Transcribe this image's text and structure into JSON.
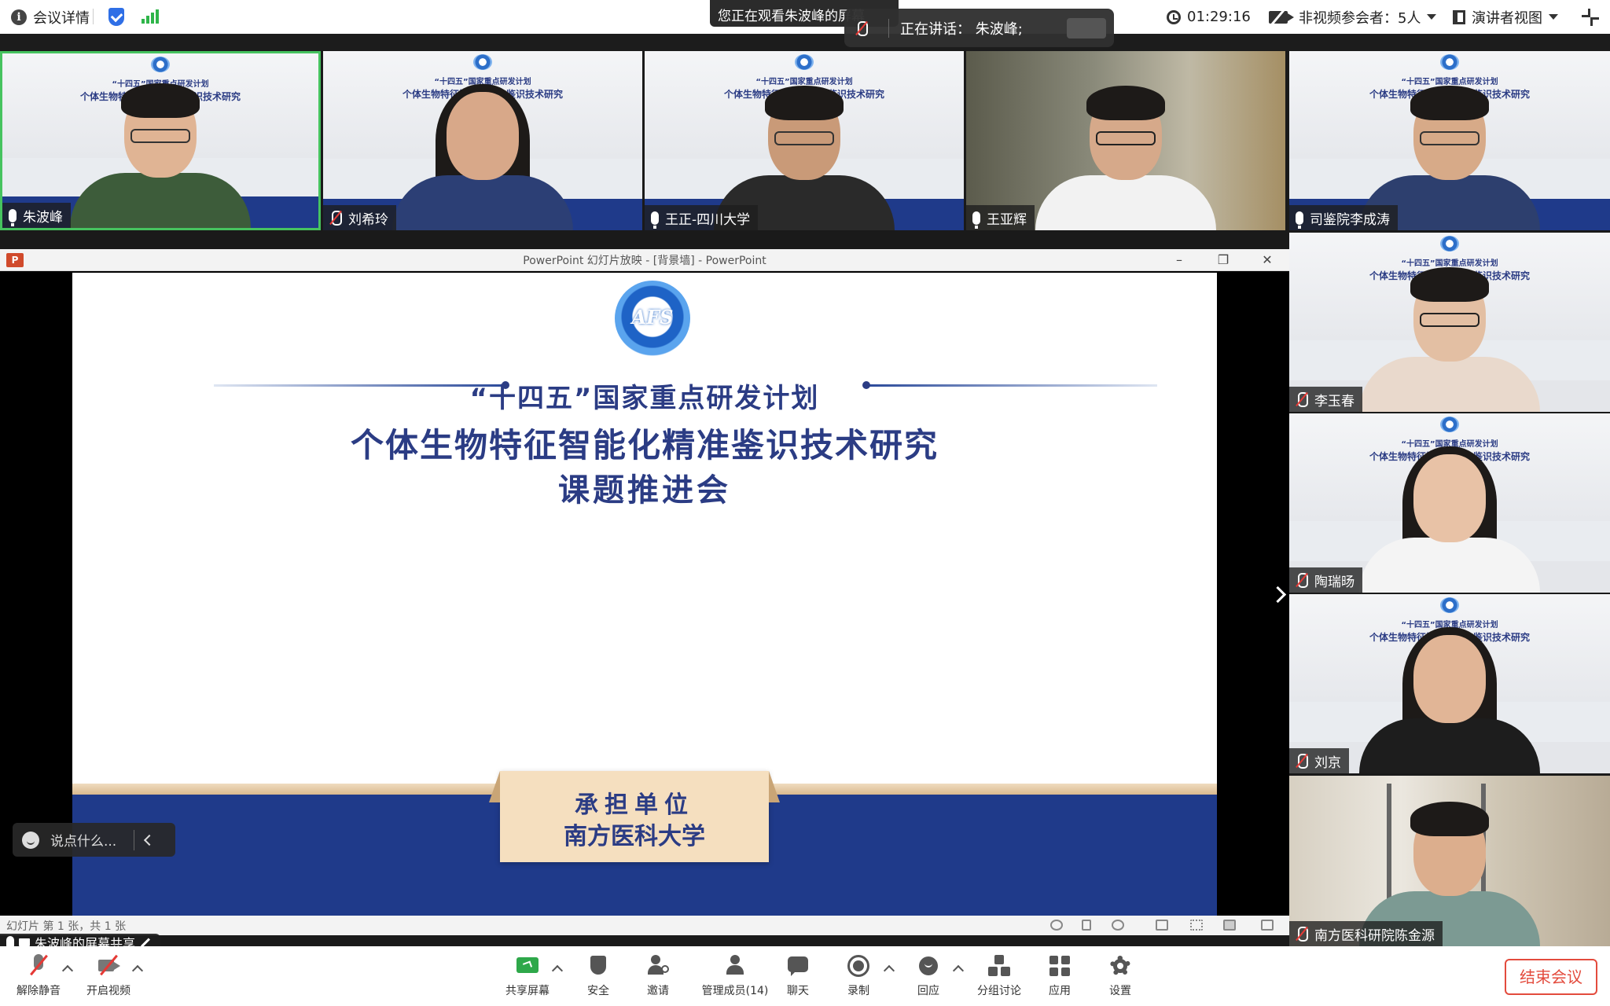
{
  "topbar": {
    "meeting_details_label": "会议详情",
    "timer": "01:29:16",
    "non_video_participants": "非视频参会者：5人",
    "view_mode": "演讲者视图"
  },
  "share_banner": "您正在观看朱波峰的屏幕",
  "speaking_banner": "正在讲话：  朱波峰;",
  "tiles": {
    "t1": {
      "name": "朱波峰"
    },
    "t2": {
      "name": "刘希玲"
    },
    "t3": {
      "name": "王正-四川大学"
    },
    "t4": {
      "name": "王亚辉"
    },
    "t5": {
      "name": "司鉴院李成涛"
    },
    "t6": {
      "name": "李玉春"
    },
    "t7": {
      "name": "陶瑞旸"
    },
    "t8": {
      "name": "刘京"
    },
    "t9": {
      "name": "南方医科研院陈金源"
    }
  },
  "tile_banner": {
    "line1": "“十四五”国家重点研发计划",
    "line2": "个体生物特征智能化精准鉴识技术研究"
  },
  "ppt": {
    "window_title": "PowerPoint 幻灯片放映 - [背景墙] - PowerPoint",
    "slide_count": "幻灯片 第 1 张，共 1 张",
    "slide": {
      "logo_text": "AFS",
      "heading1": "“十四五”国家重点研发计划",
      "heading2": "个体生物特征智能化精准鉴识技术研究",
      "heading3": "课题推进会",
      "plaque_line1": "承担单位",
      "plaque_line2": "南方医科大学"
    }
  },
  "comment_placeholder": "说点什么...",
  "share_indicator": "朱波峰的屏幕共享",
  "toolbar": {
    "unmute": "解除静音",
    "start_video": "开启视频",
    "share_screen": "共享屏幕",
    "security": "安全",
    "invite": "邀请",
    "manage_members": "管理成员(14)",
    "chat": "聊天",
    "record": "录制",
    "reactions": "回应",
    "breakout": "分组讨论",
    "apps": "应用",
    "settings": "设置",
    "end_meeting": "结束会议"
  },
  "colors": {
    "accent_blue": "#1f3a8a",
    "end_red": "#e34b3d",
    "active_tile_border": "#46c35f"
  }
}
